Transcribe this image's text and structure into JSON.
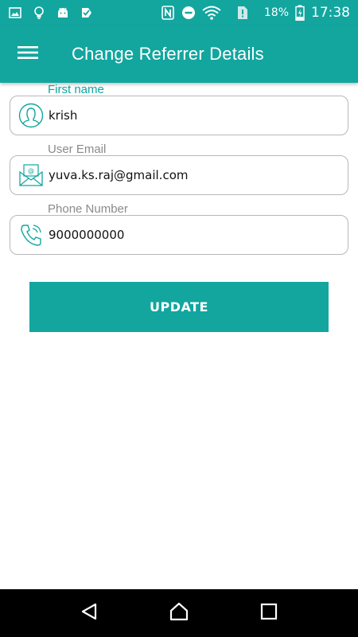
{
  "status_bar": {
    "battery_percent": "18%",
    "time": "17:38",
    "icons": [
      "image-icon",
      "lightbulb-icon",
      "android-icon",
      "checklist-icon",
      "nfc-icon",
      "dnd-icon",
      "wifi-icon",
      "sim-alert-icon",
      "battery-charging-icon"
    ]
  },
  "app_bar": {
    "title": "Change Referrer Details",
    "menu_icon": "hamburger-menu-icon"
  },
  "form": {
    "first_name": {
      "label": "First name",
      "value": "krish",
      "icon": "user-icon"
    },
    "email": {
      "label": "User Email",
      "value": "yuva.ks.raj@gmail.com",
      "icon": "mail-icon"
    },
    "phone": {
      "label": "Phone Number",
      "value": "9000000000",
      "icon": "phone-icon"
    }
  },
  "actions": {
    "update_label": "UPDATE"
  },
  "colors": {
    "primary": "#12a69f",
    "nav_bar": "#000000"
  }
}
